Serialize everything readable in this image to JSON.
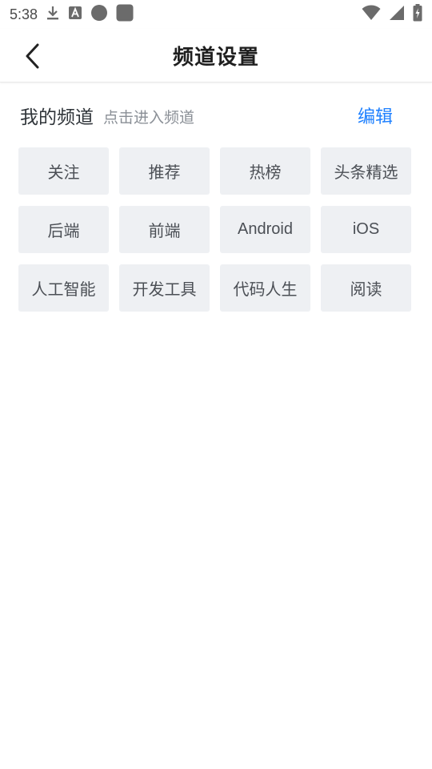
{
  "status_bar": {
    "time": "5:38",
    "left_icons": [
      "download-icon",
      "font-a-icon",
      "circle-icon",
      "square-icon"
    ],
    "right_icons": [
      "wifi-icon",
      "signal-icon",
      "battery-charging-icon"
    ]
  },
  "app_bar": {
    "title": "频道设置",
    "back_icon": "chevron-left-icon"
  },
  "my_channels": {
    "title": "我的频道",
    "hint": "点击进入频道",
    "edit_label": "编辑",
    "accent_color": "#1e80ff"
  },
  "channels": [
    "关注",
    "推荐",
    "热榜",
    "头条精选",
    "后端",
    "前端",
    "Android",
    "iOS",
    "人工智能",
    "开发工具",
    "代码人生",
    "阅读"
  ]
}
